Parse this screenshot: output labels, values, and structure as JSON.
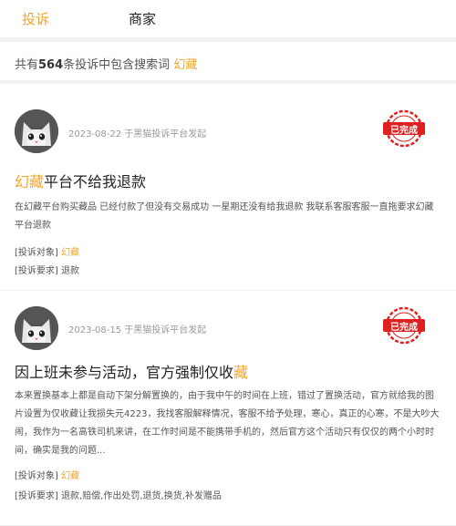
{
  "tabs": {
    "complaints": "投诉",
    "merchants": "商家"
  },
  "summary": {
    "prefix": "共有",
    "count": "564",
    "middle": "条投诉中包含搜索词",
    "keyword": "幻藏"
  },
  "colors": {
    "accent": "#f2a52a",
    "stamp_red": "#e02020"
  },
  "complaints": [
    {
      "date": "2023-08-22",
      "source": "于黑猫投诉平台发起",
      "status": "已完成",
      "title_highlight": "幻藏",
      "title_rest": "平台不给我退款",
      "description": "在幻藏平台购买藏品 已经付款了但没有交易成功 一星期还没有给我退款 我联系客服客服一直拖要求幻藏平台退款",
      "target_label": "[投诉对象]",
      "target_value": "幻藏",
      "request_label": "[投诉要求]",
      "request_value": "退款"
    },
    {
      "date": "2023-08-15",
      "source": "于黑猫投诉平台发起",
      "status": "已完成",
      "title_text": "因上班未参与活动，官方强制仅收",
      "title_highlight": "藏",
      "description": "本来置换基本上都是自动下架分解置换的，由于我中午的时间在上班，错过了置换活动，官方就给我的图片设置为仅收藏让我损失元4223，我找客服解释情况，客服不给予处理，寒心，真正的心寒，不是大吵大闹，我作为一名高铁司机来讲，在工作时间是不能携带手机的，然后官方这个活动只有仅仅的两个小时时间，确实是我的问题...",
      "target_label": "[投诉对象]",
      "target_value": "幻藏",
      "request_label": "[投诉要求]",
      "request_value": "退款,赔偿,作出处罚,退货,换货,补发赠品"
    }
  ]
}
